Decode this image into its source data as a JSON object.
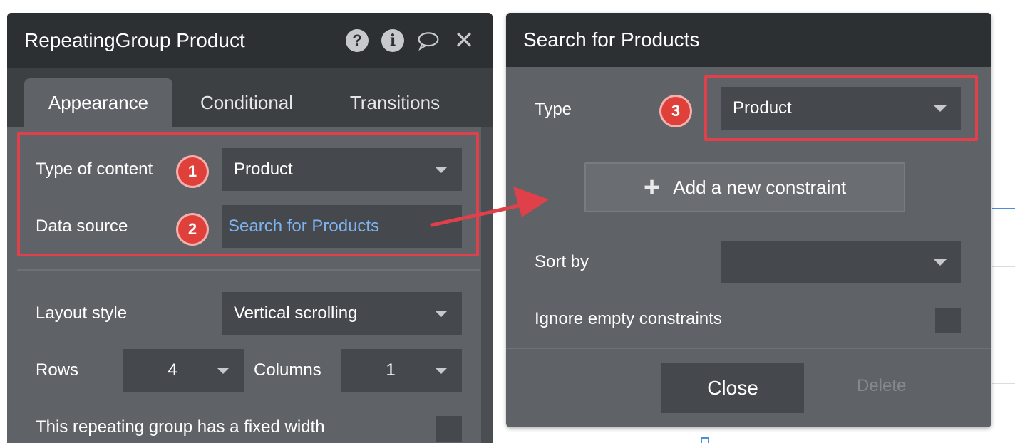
{
  "left_panel": {
    "title": "RepeatingGroup Product",
    "icons": [
      "question-icon",
      "info-icon",
      "comment-icon",
      "close-icon"
    ],
    "tabs": [
      {
        "label": "Appearance",
        "active": true
      },
      {
        "label": "Conditional",
        "active": false
      },
      {
        "label": "Transitions",
        "active": false
      }
    ],
    "fields": {
      "type_of_content": {
        "label": "Type of content",
        "value": "Product",
        "badge": "1"
      },
      "data_source": {
        "label": "Data source",
        "value": "Search for Products",
        "badge": "2"
      },
      "layout_style": {
        "label": "Layout style",
        "value": "Vertical scrolling"
      },
      "rows": {
        "label": "Rows",
        "value": "4"
      },
      "columns": {
        "label": "Columns",
        "value": "1"
      },
      "fixed_width": {
        "label": "This repeating group has a fixed width",
        "checked": false
      }
    }
  },
  "popup": {
    "title": "Search for Products",
    "type": {
      "label": "Type",
      "value": "Product",
      "badge": "3"
    },
    "add_constraint_label": "Add a new constraint",
    "sort_by": {
      "label": "Sort by",
      "value": ""
    },
    "ignore_empty": {
      "label": "Ignore empty constraints",
      "checked": false
    },
    "close_label": "Close",
    "delete_label": "Delete"
  },
  "colors": {
    "header_bg": "#2d3033",
    "panel_bg": "#5f6267",
    "input_bg": "#45484c",
    "link": "#7eb3f0",
    "highlight": "#e0404a",
    "badge": "#e0403a"
  }
}
